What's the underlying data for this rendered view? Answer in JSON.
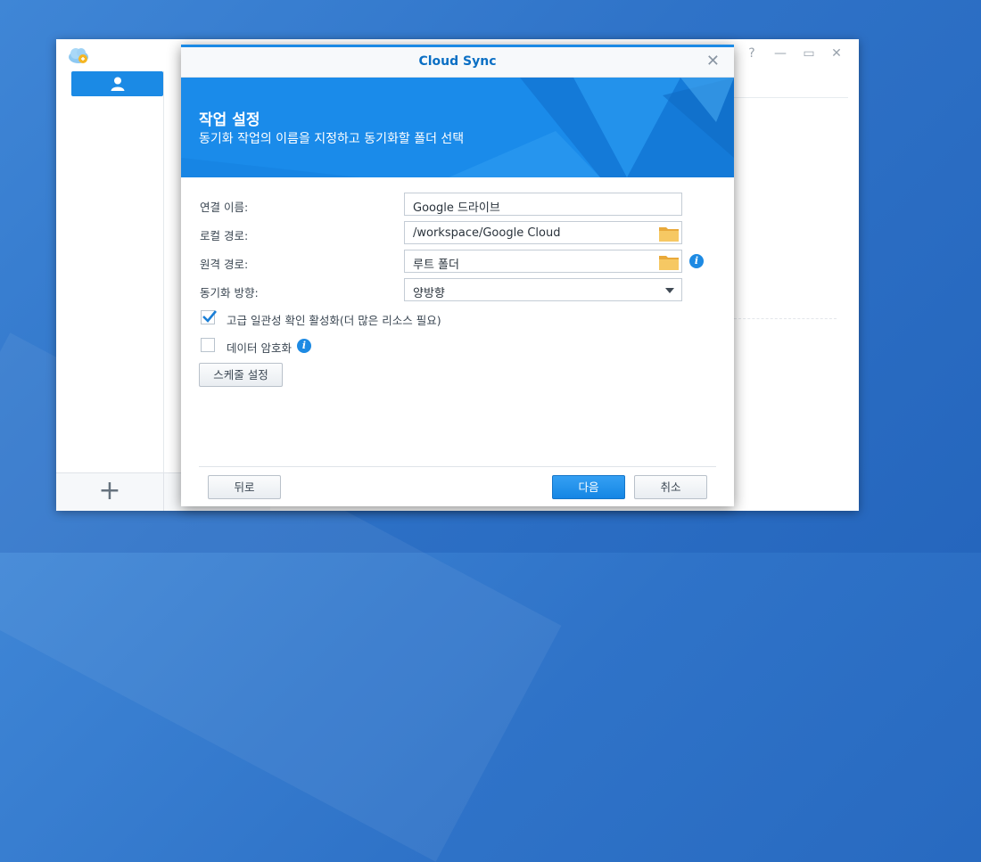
{
  "dialog": {
    "title": "Cloud Sync",
    "banner_title": "작업 설정",
    "banner_subtitle": "동기화 작업의 이름을 지정하고 동기화할 폴더 선택"
  },
  "form": {
    "connection_name": {
      "label": "연결 이름:",
      "value": "Google 드라이브"
    },
    "local_path": {
      "label": "로컬 경로:",
      "value": "/workspace/Google Cloud"
    },
    "remote_path": {
      "label": "원격 경로:",
      "value": "루트 폴더"
    },
    "sync_direction": {
      "label": "동기화 방향:",
      "value": "양방향"
    },
    "advanced_consistency": {
      "label": "고급 일관성 확인 활성화(더 많은 리소스 필요)",
      "checked": true
    },
    "data_encryption": {
      "label": "데이터 암호화",
      "checked": false
    },
    "schedule_button": "스케줄 설정"
  },
  "footer": {
    "back": "뒤로",
    "next": "다음",
    "cancel": "취소"
  },
  "icons": {
    "folder": "folder-icon",
    "info": "info-icon",
    "close": "close-icon",
    "add": "plus-icon",
    "user": "user-icon"
  },
  "colors": {
    "accent": "#1b8ae5",
    "banner": "#1a8bea",
    "title_text": "#0b6fc4"
  }
}
